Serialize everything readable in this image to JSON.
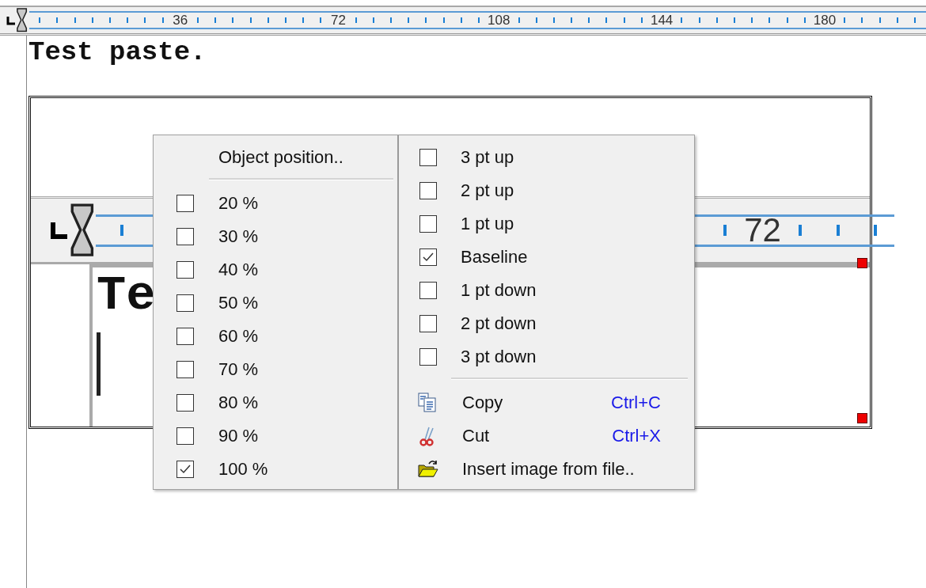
{
  "ruler": {
    "labels": [
      "36",
      "72",
      "108",
      "144",
      "180"
    ]
  },
  "document": {
    "text": "Test paste."
  },
  "embedded_image": {
    "ruler_label": "72",
    "text": "Te"
  },
  "context_menu": {
    "header": "Object position..",
    "scale_items": [
      {
        "label": "20 %",
        "checked": false
      },
      {
        "label": "30 %",
        "checked": false
      },
      {
        "label": "40 %",
        "checked": false
      },
      {
        "label": "50 %",
        "checked": false
      },
      {
        "label": "60 %",
        "checked": false
      },
      {
        "label": "70 %",
        "checked": false
      },
      {
        "label": "80 %",
        "checked": false
      },
      {
        "label": "90 %",
        "checked": false
      },
      {
        "label": "100 %",
        "checked": true
      }
    ],
    "offset_items": [
      {
        "label": "3 pt up",
        "checked": false
      },
      {
        "label": "2 pt up",
        "checked": false
      },
      {
        "label": "1 pt up",
        "checked": false
      },
      {
        "label": "Baseline",
        "checked": true
      },
      {
        "label": "1 pt down",
        "checked": false
      },
      {
        "label": "2 pt down",
        "checked": false
      },
      {
        "label": "3 pt down",
        "checked": false
      }
    ],
    "actions": [
      {
        "kind": "copy",
        "label": "Copy",
        "shortcut": "Ctrl+C"
      },
      {
        "kind": "cut",
        "label": "Cut",
        "shortcut": "Ctrl+X"
      },
      {
        "kind": "open",
        "label": "Insert image from file.."
      }
    ]
  }
}
